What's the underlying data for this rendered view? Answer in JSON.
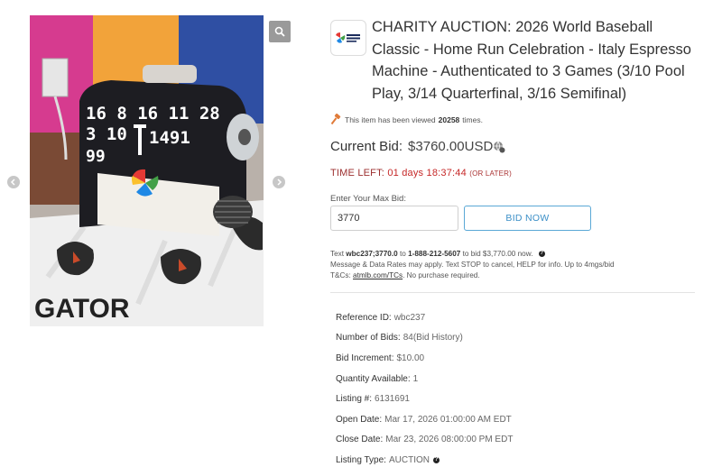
{
  "gallery": {
    "photo_printed_text": {
      "row1": "16 8 16 11 28",
      "row2": "3 10",
      "row2_right": "1491",
      "row3": "99",
      "towel": "GATOR"
    }
  },
  "listing": {
    "title": "CHARITY AUCTION: 2026 World Baseball Classic - Home Run Celebration - Italy Espresso Machine - Authenticated to 3 Games (3/10 Pool Play, 3/14 Quarterfinal, 3/16 Semifinal)",
    "views_prefix": "This item has been viewed",
    "views_count": "20258",
    "views_suffix": "times.",
    "current_bid_label": "Current Bid:",
    "current_bid_value": "$3760.00USD",
    "time_left_label": "TIME LEFT:",
    "time_left_value": "01 days 18:37:44",
    "time_left_note": "(OR LATER)",
    "max_bid_label": "Enter Your Max Bid:",
    "max_bid_value": "3770",
    "bid_button": "BID NOW"
  },
  "sms": {
    "text_word": "Text",
    "code": "wbc237;3770.0",
    "to_word": "to",
    "phone": "1-888-212-5607",
    "bid_text": "to bid $3,770.00 now.",
    "rates_line": "Message & Data Rates may apply. Text STOP to cancel, HELP for info. Up to 4mgs/bid",
    "tcs_label": "T&Cs:",
    "tcs_link": "atmlb.com/TCs",
    "tcs_suffix": ". No purchase required."
  },
  "facts": [
    {
      "label": "Reference ID:",
      "value": "wbc237"
    },
    {
      "label": "Number of Bids:",
      "value": "84(Bid History)"
    },
    {
      "label": "Bid Increment:",
      "value": "$10.00"
    },
    {
      "label": "Quantity Available:",
      "value": "1"
    },
    {
      "label": "Listing #:",
      "value": "6131691"
    },
    {
      "label": "Open Date:",
      "value": "Mar 17, 2026 01:00:00 AM EDT"
    },
    {
      "label": "Close Date:",
      "value": "Mar 23, 2026 08:00:00 PM EDT"
    },
    {
      "label": "Listing Type:",
      "value": "AUCTION"
    }
  ],
  "icons": {
    "zoom": "search-icon",
    "prev": "chevron-left-icon",
    "next": "chevron-right-icon",
    "views": "hammer-icon",
    "bid_info": "globe-icon",
    "info": "info-icon"
  },
  "colors": {
    "time_left": "#c62828",
    "bid_button": "#3b8fc7",
    "views_icon": "#e07b39"
  }
}
